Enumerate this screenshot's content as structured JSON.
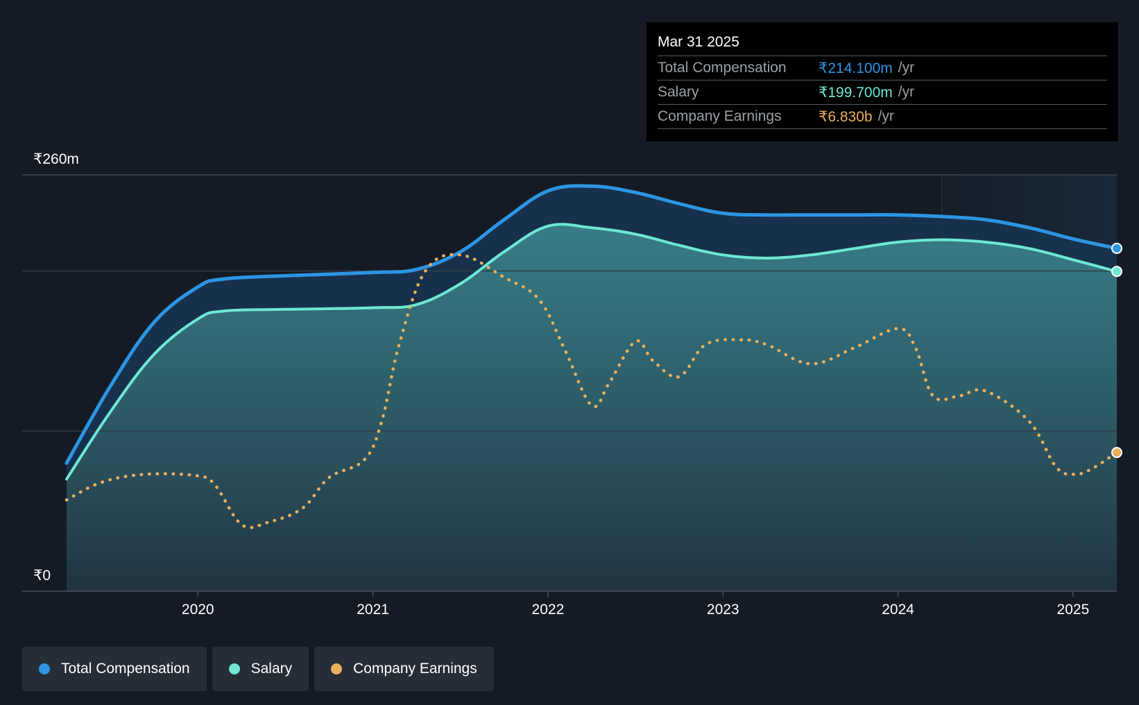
{
  "tooltip": {
    "date": "Mar 31 2025",
    "rows": [
      {
        "label": "Total Compensation",
        "value": "₹214.100m",
        "unit": "/yr",
        "color": "#2d95e3"
      },
      {
        "label": "Salary",
        "value": "₹199.700m",
        "unit": "/yr",
        "color": "#6ee7d4"
      },
      {
        "label": "Company Earnings",
        "value": "₹6.830b",
        "unit": "/yr",
        "color": "#e8b060"
      }
    ]
  },
  "legend": [
    {
      "label": "Total Compensation",
      "color": "#2d95e3"
    },
    {
      "label": "Salary",
      "color": "#6ee7d4"
    },
    {
      "label": "Company Earnings",
      "color": "#e8b060"
    }
  ],
  "colors": {
    "background": "#151b24",
    "total_compensation": "#2d95e3",
    "salary": "#6ee7d4",
    "company_earnings": "#e8b060",
    "grid": "#2f3a45"
  },
  "chart_data": {
    "type": "area",
    "y_axis_labels": [
      "₹260m",
      "₹0"
    ],
    "ylim": [
      0,
      260
    ],
    "xlim": [
      2019.25,
      2025.25
    ],
    "x_ticks": [
      2020,
      2021,
      2022,
      2023,
      2024,
      2025
    ],
    "x_tick_labels": [
      "2020",
      "2021",
      "2022",
      "2023",
      "2024",
      "2025"
    ],
    "grid": true,
    "forecast_region_start": 2024.25,
    "series": [
      {
        "name": "Total Compensation",
        "unit": "₹m",
        "points": [
          [
            2019.25,
            80
          ],
          [
            2019.5,
            128
          ],
          [
            2019.75,
            168
          ],
          [
            2020.0,
            190
          ],
          [
            2020.15,
            195
          ],
          [
            2020.5,
            197
          ],
          [
            2021.0,
            199
          ],
          [
            2021.25,
            201
          ],
          [
            2021.5,
            212
          ],
          [
            2021.75,
            232
          ],
          [
            2022.0,
            250
          ],
          [
            2022.25,
            253
          ],
          [
            2022.5,
            249
          ],
          [
            2022.75,
            242
          ],
          [
            2023.0,
            236
          ],
          [
            2023.25,
            235
          ],
          [
            2023.5,
            235
          ],
          [
            2023.75,
            235
          ],
          [
            2024.0,
            235
          ],
          [
            2024.25,
            234
          ],
          [
            2024.5,
            232
          ],
          [
            2024.75,
            227
          ],
          [
            2025.0,
            220
          ],
          [
            2025.25,
            214.1
          ]
        ]
      },
      {
        "name": "Salary",
        "unit": "₹m",
        "points": [
          [
            2019.25,
            70
          ],
          [
            2019.5,
            112
          ],
          [
            2019.75,
            148
          ],
          [
            2020.0,
            170
          ],
          [
            2020.15,
            175
          ],
          [
            2020.5,
            176
          ],
          [
            2021.0,
            177
          ],
          [
            2021.25,
            179
          ],
          [
            2021.5,
            192
          ],
          [
            2021.75,
            212
          ],
          [
            2022.0,
            228
          ],
          [
            2022.25,
            227
          ],
          [
            2022.5,
            223
          ],
          [
            2022.75,
            216
          ],
          [
            2023.0,
            210
          ],
          [
            2023.25,
            208
          ],
          [
            2023.5,
            210
          ],
          [
            2023.75,
            214
          ],
          [
            2024.0,
            218
          ],
          [
            2024.25,
            219.5
          ],
          [
            2024.5,
            218
          ],
          [
            2024.75,
            214
          ],
          [
            2025.0,
            207
          ],
          [
            2025.25,
            199.7
          ]
        ]
      },
      {
        "name": "Company Earnings",
        "unit": "₹b",
        "points": [
          [
            2019.25,
            5.35
          ],
          [
            2019.45,
            5.9
          ],
          [
            2019.7,
            6.15
          ],
          [
            2020.0,
            6.1
          ],
          [
            2020.1,
            5.8
          ],
          [
            2020.25,
            4.58
          ],
          [
            2020.4,
            4.65
          ],
          [
            2020.6,
            5.1
          ],
          [
            2020.75,
            6.05
          ],
          [
            2020.95,
            6.6
          ],
          [
            2021.05,
            7.8
          ],
          [
            2021.15,
            10.2
          ],
          [
            2021.3,
            12.5
          ],
          [
            2021.5,
            13.0
          ],
          [
            2021.75,
            12.3
          ],
          [
            2021.95,
            11.6
          ],
          [
            2022.1,
            10.0
          ],
          [
            2022.25,
            8.3
          ],
          [
            2022.35,
            9.0
          ],
          [
            2022.5,
            10.3
          ],
          [
            2022.6,
            9.7
          ],
          [
            2022.75,
            9.2
          ],
          [
            2022.9,
            10.2
          ],
          [
            2023.1,
            10.35
          ],
          [
            2023.25,
            10.2
          ],
          [
            2023.5,
            9.6
          ],
          [
            2023.75,
            10.1
          ],
          [
            2024.0,
            10.7
          ],
          [
            2024.1,
            10.1
          ],
          [
            2024.2,
            8.6
          ],
          [
            2024.35,
            8.6
          ],
          [
            2024.5,
            8.75
          ],
          [
            2024.75,
            7.8
          ],
          [
            2024.9,
            6.4
          ],
          [
            2025.0,
            6.15
          ],
          [
            2025.1,
            6.3
          ],
          [
            2025.25,
            6.83
          ]
        ]
      }
    ]
  }
}
